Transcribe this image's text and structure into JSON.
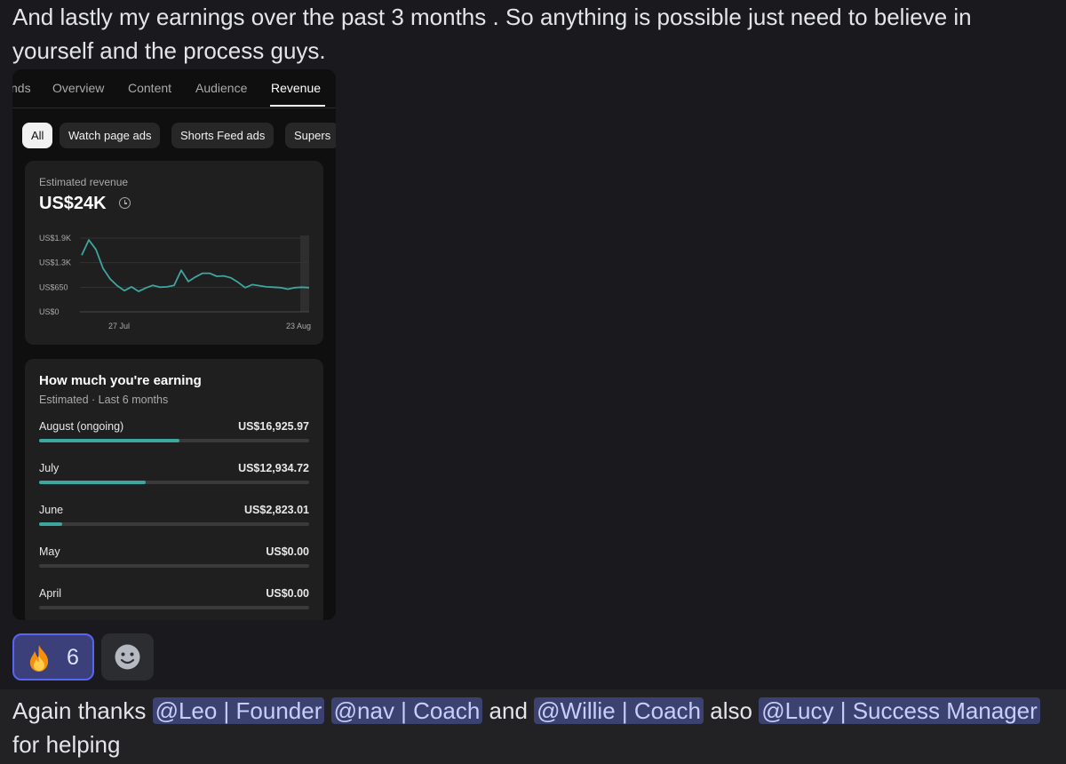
{
  "message_top": "And lastly my earnings over the past 3 months . So anything is possible just need to believe in yourself and the process guys.",
  "screenshot": {
    "tabs": [
      "nds",
      "Overview",
      "Content",
      "Audience",
      "Revenue"
    ],
    "active_tab": "Revenue",
    "chips": [
      "All",
      "Watch page ads",
      "Shorts Feed ads",
      "Supers"
    ],
    "active_chip": "All",
    "revenue": {
      "label": "Estimated revenue",
      "value": "US$24K"
    },
    "earnings": {
      "title": "How much you're earning",
      "subtitle": "Estimated · Last 6 months",
      "rows": [
        {
          "month": "August (ongoing)",
          "amount": "US$16,925.97"
        },
        {
          "month": "July",
          "amount": "US$12,934.72"
        },
        {
          "month": "June",
          "amount": "US$2,823.01"
        },
        {
          "month": "May",
          "amount": "US$0.00"
        },
        {
          "month": "April",
          "amount": "US$0.00"
        }
      ],
      "fractions": [
        0.52,
        0.395,
        0.085,
        0,
        0
      ]
    }
  },
  "chart_data": {
    "type": "line",
    "title": "",
    "xlabel": "",
    "ylabel": "",
    "x_ticks": [
      "27 Jul",
      "23 Aug"
    ],
    "y_ticks": [
      "US$1.9K",
      "US$1.3K",
      "US$650",
      "US$0"
    ],
    "ylim": [
      0,
      1950
    ],
    "x": [
      "22 Jul",
      "23 Jul",
      "24 Jul",
      "25 Jul",
      "26 Jul",
      "27 Jul",
      "28 Jul",
      "29 Jul",
      "30 Jul",
      "31 Jul",
      "1 Aug",
      "2 Aug",
      "3 Aug",
      "4 Aug",
      "5 Aug",
      "6 Aug",
      "7 Aug",
      "8 Aug",
      "9 Aug",
      "10 Aug",
      "11 Aug",
      "12 Aug",
      "13 Aug",
      "14 Aug",
      "15 Aug",
      "16 Aug",
      "17 Aug",
      "18 Aug",
      "19 Aug",
      "20 Aug",
      "21 Aug",
      "22 Aug",
      "23 Aug"
    ],
    "series": [
      {
        "values": [
          1500,
          1900,
          1650,
          1150,
          870,
          690,
          560,
          660,
          540,
          630,
          700,
          650,
          660,
          700,
          1100,
          800,
          920,
          1020,
          1020,
          940,
          950,
          900,
          780,
          640,
          720,
          690,
          660,
          650,
          640,
          600,
          640,
          650,
          640
        ]
      }
    ],
    "color": "#3ea6a0"
  },
  "reactions": {
    "fire_count": "6",
    "fire_emoji": "🔥"
  },
  "message_bottom": {
    "text_before": "Again thanks",
    "mention1": "@Leo | Founder",
    "mention2": "@nav | Coach",
    "text_and": "and",
    "mention3": "@Willie | Coach",
    "text_also": "also",
    "mention4": "@Lucy | Success Manager",
    "text_after": "for helping"
  },
  "colors": {
    "background": "#1a1a1e",
    "mention_bg": "#3c4270",
    "mention_fg": "#c9cdfb",
    "accent": "#3ea6a0",
    "reaction_border": "#5865f2"
  }
}
